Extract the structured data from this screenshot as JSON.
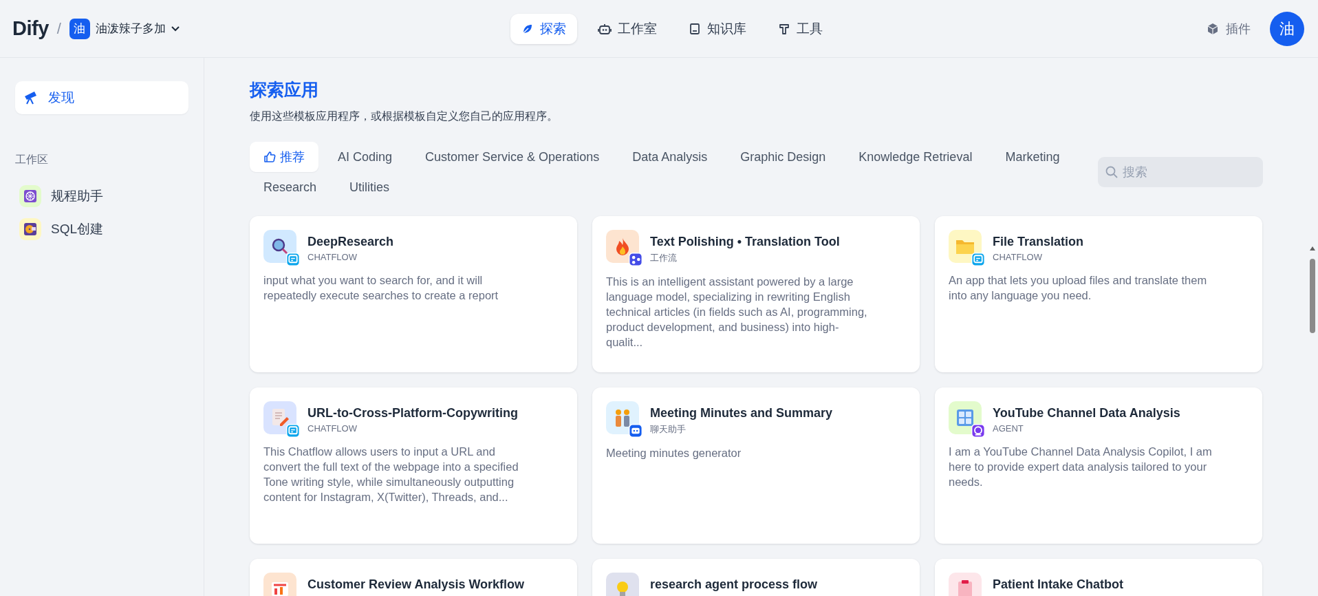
{
  "header": {
    "logo": "Dify",
    "separator": "/",
    "workspace": {
      "avatar": "油",
      "name": "油泼辣子多加"
    },
    "nav": [
      {
        "label": "探索",
        "selected": true
      },
      {
        "label": "工作室",
        "selected": false
      },
      {
        "label": "知识库",
        "selected": false
      },
      {
        "label": "工具",
        "selected": false
      }
    ],
    "plugins": "插件",
    "user_avatar": "油"
  },
  "sidebar": {
    "discover": {
      "label": "发现",
      "selected": true
    },
    "section": "工作区",
    "items": [
      {
        "label": "规程助手",
        "color": "#e3fbcc"
      },
      {
        "label": "SQL创建",
        "color": "#fef7c3"
      }
    ]
  },
  "main": {
    "title": "探索应用",
    "subtitle": "使用这些模板应用程序，或根据模板自定义您自己的应用程序。",
    "categories": [
      {
        "label": "推荐",
        "selected": true
      },
      {
        "label": "AI Coding",
        "selected": false
      },
      {
        "label": "Customer Service & Operations",
        "selected": false
      },
      {
        "label": "Data Analysis",
        "selected": false
      },
      {
        "label": "Graphic Design",
        "selected": false
      },
      {
        "label": "Knowledge Retrieval",
        "selected": false
      },
      {
        "label": "Marketing",
        "selected": false
      },
      {
        "label": "Research",
        "selected": false
      },
      {
        "label": "Utilities",
        "selected": false
      }
    ],
    "search": {
      "placeholder": "搜索"
    },
    "apps": [
      {
        "title": "DeepResearch",
        "type": "CHATFLOW",
        "kind": "chatflow",
        "color": "#d1e9ff",
        "description": "input what you want to search for, and it will repeatedly execute searches to create a report"
      },
      {
        "title": "Text Polishing • Translation Tool",
        "type": "工作流",
        "kind": "workflow",
        "color": "#fde4d0",
        "description": "This is an intelligent assistant powered by a large language model, specializing in rewriting English technical articles (in fields such as AI, programming, product development, and business) into high-qualit..."
      },
      {
        "title": "File Translation",
        "type": "CHATFLOW",
        "kind": "chatflow",
        "color": "#fef7c3",
        "description": "An app that lets you upload files and translate them into any language you need."
      },
      {
        "title": "URL-to-Cross-Platform-Copywriting",
        "type": "CHATFLOW",
        "kind": "chatflow",
        "color": "#d9e3ff",
        "description": "This Chatflow allows users to input a URL and convert the full text of the webpage into a specified Tone writing style, while simultaneously outputting content for Instagram, X(Twitter), Threads, and..."
      },
      {
        "title": "Meeting Minutes and Summary",
        "type": "聊天助手",
        "kind": "chatbot",
        "color": "#e0f2fe",
        "description": "Meeting minutes generator"
      },
      {
        "title": "YouTube Channel Data Analysis",
        "type": "AGENT",
        "kind": "agent",
        "color": "#e3fbcc",
        "description": "I am a YouTube Channel Data Analysis Copilot, I am here to provide expert data analysis tailored to your needs."
      },
      {
        "title": "Customer Review Analysis Workflow",
        "color": "#fde4d0"
      },
      {
        "title": "research agent process flow",
        "color": "#dfe1ee"
      },
      {
        "title": "Patient Intake Chatbot",
        "color": "#fde6ea"
      }
    ]
  }
}
